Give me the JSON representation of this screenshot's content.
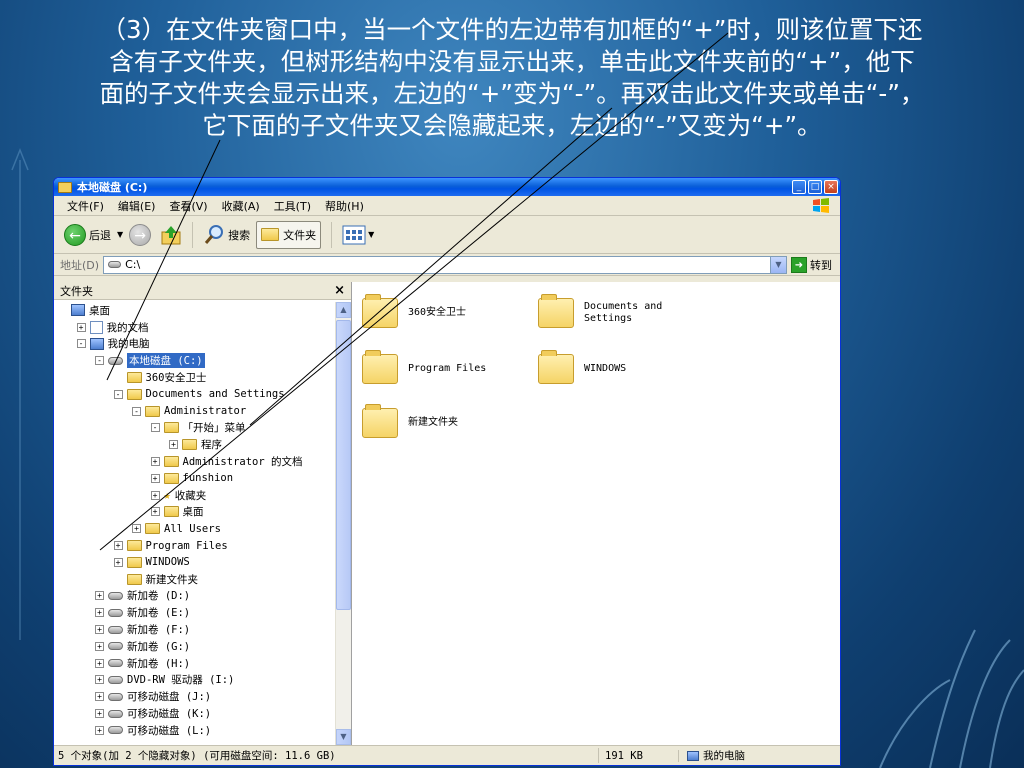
{
  "slide": {
    "lines": [
      "（3）在文件夹窗口中，当一个文件的左边带有加框的“+”时，则该位置下还",
      "含有子文件夹，但树形结构中没有显示出来，单击此文件夹前的“+”，他下",
      "面的子文件夹会显示出来，左边的“+”变为“-”。再双击此文件夹或单击“-”，",
      "它下面的子文件夹又会隐藏起来，左边的“-”又变为“+”。"
    ]
  },
  "window": {
    "title": "本地磁盘 (C:)",
    "menu": [
      "文件(F)",
      "编辑(E)",
      "查看(V)",
      "收藏(A)",
      "工具(T)",
      "帮助(H)"
    ],
    "toolbar": {
      "back": "后退",
      "search": "搜索",
      "folders": "文件夹"
    },
    "address": {
      "label": "地址(D)",
      "value": "C:\\",
      "go": "转到"
    },
    "pane_title": "文件夹",
    "tree": [
      {
        "indent": 0,
        "exp": "",
        "icon": "desktop",
        "label": "桌面"
      },
      {
        "indent": 1,
        "exp": "+",
        "icon": "doc",
        "label": "我的文档"
      },
      {
        "indent": 1,
        "exp": "-",
        "icon": "computer",
        "label": "我的电脑"
      },
      {
        "indent": 2,
        "exp": "-",
        "icon": "drive",
        "label": "本地磁盘 (C:)",
        "selected": true
      },
      {
        "indent": 3,
        "exp": "",
        "icon": "folder",
        "label": "360安全卫士"
      },
      {
        "indent": 3,
        "exp": "-",
        "icon": "folder",
        "label": "Documents and Settings"
      },
      {
        "indent": 4,
        "exp": "-",
        "icon": "folder",
        "label": "Administrator"
      },
      {
        "indent": 5,
        "exp": "-",
        "icon": "folder",
        "label": "「开始」菜单"
      },
      {
        "indent": 6,
        "exp": "+",
        "icon": "folder",
        "label": "程序"
      },
      {
        "indent": 5,
        "exp": "+",
        "icon": "folder",
        "label": "Administrator 的文档"
      },
      {
        "indent": 5,
        "exp": "+",
        "icon": "folder",
        "label": "funshion"
      },
      {
        "indent": 5,
        "exp": "+",
        "icon": "star",
        "label": "收藏夹"
      },
      {
        "indent": 5,
        "exp": "+",
        "icon": "folder",
        "label": "桌面"
      },
      {
        "indent": 4,
        "exp": "+",
        "icon": "folder",
        "label": "All Users"
      },
      {
        "indent": 3,
        "exp": "+",
        "icon": "folder",
        "label": "Program Files"
      },
      {
        "indent": 3,
        "exp": "+",
        "icon": "folder",
        "label": "WINDOWS"
      },
      {
        "indent": 3,
        "exp": "",
        "icon": "folder",
        "label": "新建文件夹"
      },
      {
        "indent": 2,
        "exp": "+",
        "icon": "drive",
        "label": "新加卷 (D:)"
      },
      {
        "indent": 2,
        "exp": "+",
        "icon": "drive",
        "label": "新加卷 (E:)"
      },
      {
        "indent": 2,
        "exp": "+",
        "icon": "drive",
        "label": "新加卷 (F:)"
      },
      {
        "indent": 2,
        "exp": "+",
        "icon": "drive",
        "label": "新加卷 (G:)"
      },
      {
        "indent": 2,
        "exp": "+",
        "icon": "drive",
        "label": "新加卷 (H:)"
      },
      {
        "indent": 2,
        "exp": "+",
        "icon": "dvd",
        "label": "DVD-RW 驱动器 (I:)"
      },
      {
        "indent": 2,
        "exp": "+",
        "icon": "drive",
        "label": "可移动磁盘 (J:)"
      },
      {
        "indent": 2,
        "exp": "+",
        "icon": "drive",
        "label": "可移动磁盘 (K:)"
      },
      {
        "indent": 2,
        "exp": "+",
        "icon": "drive",
        "label": "可移动磁盘 (L:)"
      }
    ],
    "files": [
      {
        "label": "360安全卫士"
      },
      {
        "label": "Documents and Settings"
      },
      {
        "label": "Program Files"
      },
      {
        "label": "WINDOWS"
      },
      {
        "label": "新建文件夹"
      }
    ],
    "status": {
      "objects": "5 个对象(加 2 个隐藏对象) (可用磁盘空间: 11.6 GB)",
      "size": "191 KB",
      "location": "我的电脑"
    }
  },
  "colors": {
    "selection": "#316ac5",
    "titlebar": "#0054e3",
    "slide_bg": "#1f5f99"
  }
}
